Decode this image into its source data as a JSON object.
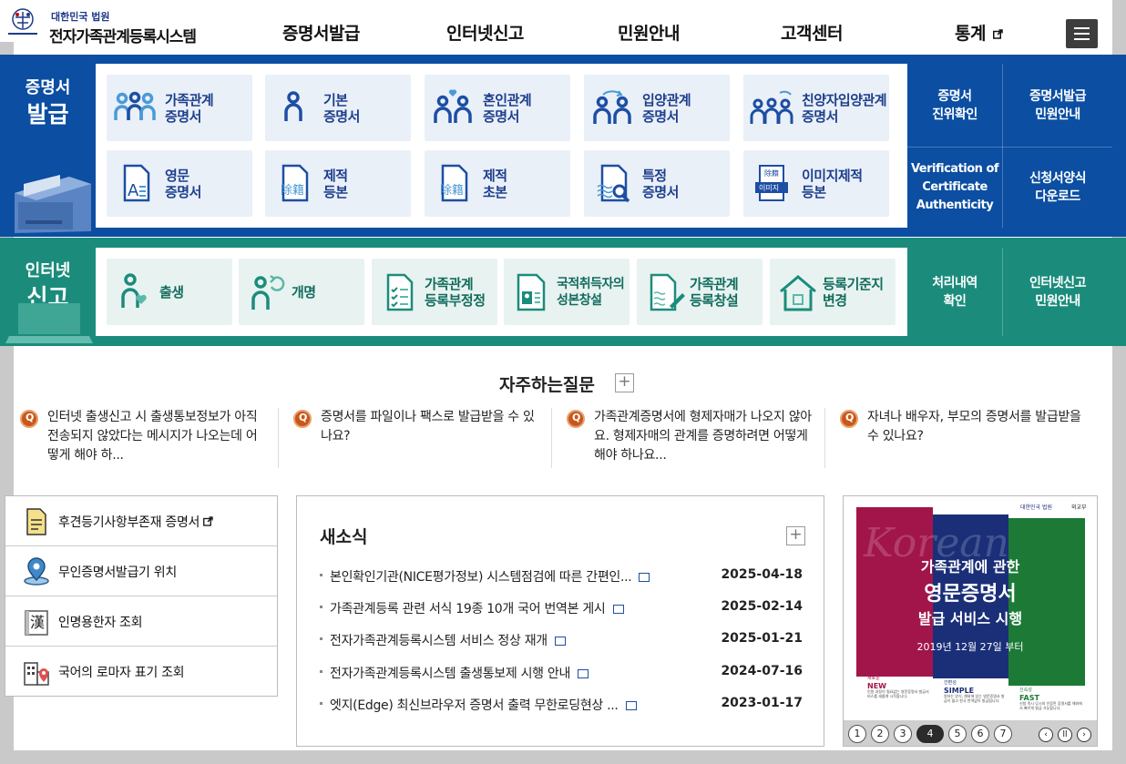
{
  "header": {
    "org": "대한민국 법원",
    "title": "전자가족관계등록시스템",
    "nav": [
      {
        "label": "증명서발급"
      },
      {
        "label": "인터넷신고"
      },
      {
        "label": "민원안내"
      },
      {
        "label": "고객센터"
      },
      {
        "label": "통계",
        "external_icon": "external-link-icon"
      }
    ],
    "menu_icon": "hamburger-menu-icon"
  },
  "cert_section": {
    "label_line1": "증명서",
    "label_line2": "발급",
    "tiles": [
      {
        "line1": "가족관계",
        "line2": "증명서",
        "icon": "family-icon"
      },
      {
        "line1": "기본",
        "line2": "증명서",
        "icon": "person-icon"
      },
      {
        "line1": "혼인관계",
        "line2": "증명서",
        "icon": "couple-heart-icon"
      },
      {
        "line1": "입양관계",
        "line2": "증명서",
        "icon": "adoption-icon"
      },
      {
        "line1": "친양자입양관계",
        "line2": "증명서",
        "icon": "family-adoption-icon"
      },
      {
        "line1": "영문",
        "line2": "증명서",
        "icon": "english-doc-icon"
      },
      {
        "line1": "제적",
        "line2": "등본",
        "icon": "removed-register-doc-icon",
        "badge": "除籍"
      },
      {
        "line1": "제적",
        "line2": "초본",
        "icon": "removed-register-extract-icon",
        "badge": "除籍"
      },
      {
        "line1": "특정",
        "line2": "증명서",
        "icon": "doc-search-icon"
      },
      {
        "line1": "이미지제적",
        "line2": "등본",
        "icon": "image-register-icon",
        "badge_top": "除籍",
        "badge": "이미지"
      }
    ],
    "side_buttons": [
      {
        "line1": "증명서",
        "line2": "진위확인"
      },
      {
        "line1": "증명서발급",
        "line2": "민원안내"
      },
      {
        "line1": "Verification of",
        "line2": "Certificate",
        "line3": "Authenticity"
      },
      {
        "line1": "신청서양식",
        "line2": "다운로드"
      }
    ]
  },
  "report_section": {
    "label_line1": "인터넷",
    "label_line2": "신고",
    "tiles": [
      {
        "line1": "출생",
        "line2": "",
        "icon": "birth-icon"
      },
      {
        "line1": "개명",
        "line2": "",
        "icon": "rename-icon"
      },
      {
        "line1": "가족관계",
        "line2": "등록부정정",
        "icon": "checklist-icon"
      },
      {
        "line1": "국적취득자의",
        "line2": "성본창설",
        "icon": "id-card-icon"
      },
      {
        "line1": "가족관계",
        "line2": "등록창설",
        "icon": "doc-pen-icon"
      },
      {
        "line1": "등록기준지",
        "line2": "변경",
        "icon": "house-icon"
      }
    ],
    "side_buttons": [
      {
        "line1": "처리내역",
        "line2": "확인"
      },
      {
        "line1": "인터넷신고",
        "line2": "민원안내"
      }
    ]
  },
  "faq": {
    "title": "자주하는질문",
    "more": "+",
    "items": [
      {
        "q": "Q",
        "text": "인터넷 출생신고 시 출생통보정보가 아직 전송되지 않았다는 메시지가 나오는데 어떻게 해야 하..."
      },
      {
        "q": "Q",
        "text": "증명서를 파일이나 팩스로 발급받을 수 있나요?"
      },
      {
        "q": "Q",
        "text": "가족관계증명서에 형제자매가 나오지 않아요. 형제자매의 관계를 증명하려면 어떻게 해야 하나요..."
      },
      {
        "q": "Q",
        "text": "자녀나 배우자, 부모의 증명서를 발급받을 수 있나요?"
      }
    ]
  },
  "quick_links": [
    {
      "label": "후견등기사항부존재 증명서",
      "icon": "document-icon",
      "external": "external-link-icon"
    },
    {
      "label": "무인증명서발급기 위치",
      "icon": "location-pin-icon"
    },
    {
      "label": "인명용한자 조회",
      "icon": "hanja-book-icon",
      "icon_text": "漢"
    },
    {
      "label": "국어의 로마자 표기 조회",
      "icon": "building-pin-icon"
    }
  ],
  "news": {
    "title": "새소식",
    "more": "+",
    "items": [
      {
        "title": "본인확인기관(NICE평가정보) 시스템점검에 따른 간편인...",
        "date": "2025-04-18"
      },
      {
        "title": "가족관계등록 관련 서식 19종 10개 국어 번역본 게시",
        "date": "2025-02-14"
      },
      {
        "title": "전자가족관계등록시스템 서비스 정상 재개",
        "date": "2025-01-21"
      },
      {
        "title": "전자가족관계등록시스템 출생통보제 시행 안내",
        "date": "2024-07-16"
      },
      {
        "title": "엣지(Edge) 최신브라우저 증명서 출력 무한로딩현상 ...",
        "date": "2023-01-17"
      }
    ]
  },
  "banner": {
    "logo1": "대한민국 법원",
    "logo2": "외교부",
    "bg_word": "Korean",
    "line1": "가족관계에 관한",
    "line2": "영문증명서",
    "line3": "발급 서비스 시행",
    "date": "2019년 12월 27일 부터",
    "tags": [
      {
        "small": "새로운",
        "big": "NEW",
        "desc": "민원 과정이 필요없는 영문증명서 발급서비스를 새롭게 시작합니다."
      },
      {
        "small": "간편성",
        "big": "SIMPLE",
        "desc": "원하는 양식, 해외에 있는 영문증명서 발급이 쉽고 한국 번역없이 발급됩니다."
      },
      {
        "small": "신속성",
        "big": "FAST",
        "desc": "신청 즉시 당시의 인증된 증명서를 해외에서 빠르게 발급 가능합니다."
      }
    ],
    "pages": [
      "1",
      "2",
      "3",
      "4",
      "5",
      "6",
      "7"
    ],
    "active_page": "4",
    "controls": {
      "prev": "‹",
      "pause": "ll",
      "next": "›"
    }
  },
  "colors": {
    "cert_band": "#0b4ea2",
    "report_band": "#1b8c7c",
    "faq_q": "#c7581a"
  }
}
